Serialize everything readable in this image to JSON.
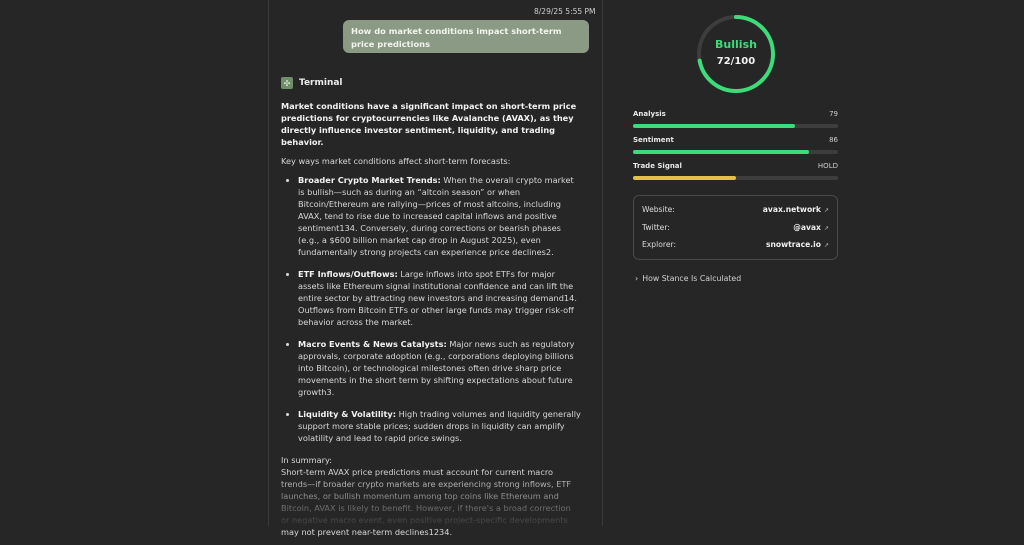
{
  "chat": {
    "timestamp": "8/29/25 5:55 PM",
    "user_message": "How do market conditions impact short-term price predictions",
    "assistant": {
      "name": "Terminal",
      "intro": "Market conditions have a significant impact on short-term price predictions for cryptocurrencies like Avalanche (AVAX), as they directly influence investor sentiment, liquidity, and trading behavior.",
      "lead": "Key ways market conditions affect short-term forecasts:",
      "bullets": [
        {
          "title": "Broader Crypto Market Trends:",
          "text": " When the overall crypto market is bullish—such as during an “altcoin season” or when Bitcoin/Ethereum are rallying—prices of most altcoins, including AVAX, tend to rise due to increased capital inflows and positive sentiment134. Conversely, during corrections or bearish phases (e.g., a $600 billion market cap drop in August 2025), even fundamentally strong projects can experience price declines2."
        },
        {
          "title": "ETF Inflows/Outflows:",
          "text": " Large inflows into spot ETFs for major assets like Ethereum signal institutional confidence and can lift the entire sector by attracting new investors and increasing demand14. Outflows from Bitcoin ETFs or other large funds may trigger risk-off behavior across the market."
        },
        {
          "title": "Macro Events & News Catalysts:",
          "text": " Major news such as regulatory approvals, corporate adoption (e.g., corporations deploying billions into Bitcoin), or technological milestones often drive sharp price movements in the short term by shifting expectations about future growth3."
        },
        {
          "title": "Liquidity & Volatility:",
          "text": " High trading volumes and liquidity generally support more stable prices; sudden drops in liquidity can amplify volatility and lead to rapid price swings."
        }
      ],
      "summary_label": "In summary:",
      "summary": "Short-term AVAX price predictions must account for current macro trends—if broader crypto markets are experiencing strong inflows, ETF launches, or bullish momentum among top coins like Ethereum and Bitcoin, AVAX is likely to benefit. However, if there's a broad correction or negative macro event, even positive project-specific developments may not prevent near-term declines1234."
    }
  },
  "sidebar": {
    "stance": {
      "label": "Bullish",
      "score_text": "72/100",
      "score": 72,
      "max": 100,
      "color": "#3ddc7a"
    },
    "metrics": [
      {
        "name": "Analysis",
        "value_text": "79",
        "fraction": 0.79,
        "color": "#3ddc7a"
      },
      {
        "name": "Sentiment",
        "value_text": "86",
        "fraction": 0.86,
        "color": "#3ddc7a"
      },
      {
        "name": "Trade Signal",
        "value_text": "HOLD",
        "fraction": 0.5,
        "color": "#e2c04a"
      }
    ],
    "links": [
      {
        "key": "Website:",
        "value": "avax.network"
      },
      {
        "key": "Twitter:",
        "value": "@avax"
      },
      {
        "key": "Explorer:",
        "value": "snowtrace.io"
      }
    ],
    "stance_calc_label": "How Stance Is Calculated",
    "icons": {
      "external": "external-link-icon",
      "chevron": "chevron-right-icon",
      "logo": "terminal-logo-icon"
    }
  }
}
